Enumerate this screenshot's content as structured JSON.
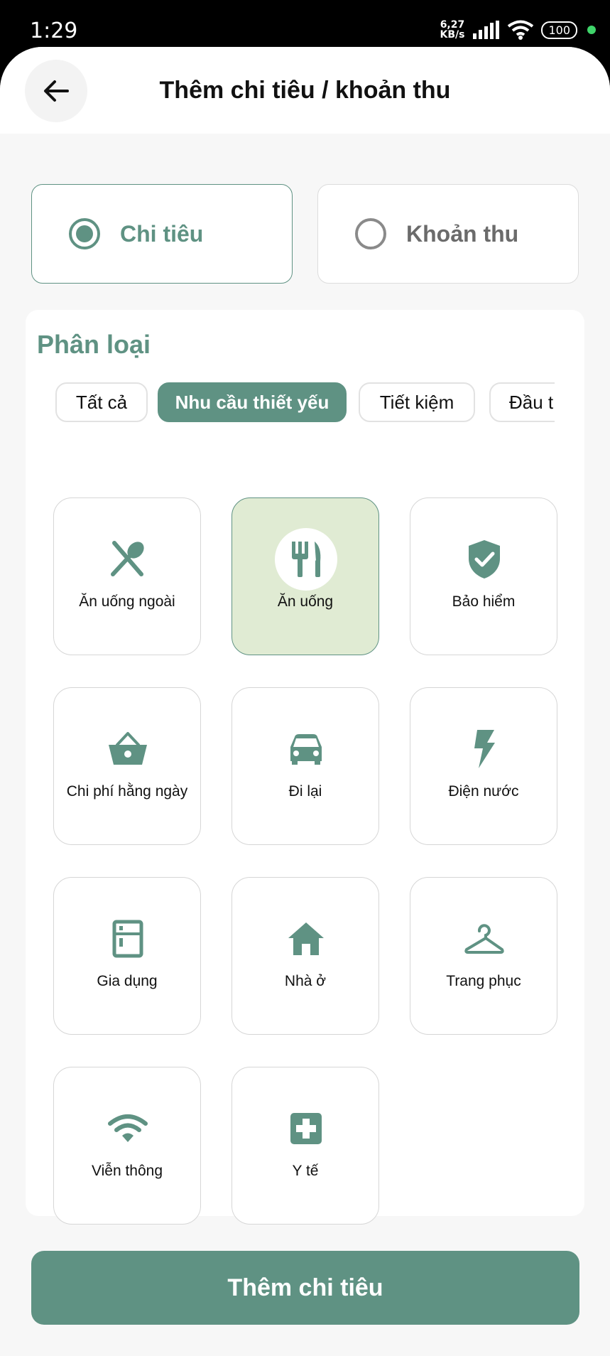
{
  "status_bar": {
    "time": "1:29",
    "net_speed_value": "6,27",
    "net_speed_unit": "KB/s",
    "battery": "100"
  },
  "header": {
    "title": "Thêm chi tiêu / khoản thu"
  },
  "type_toggle": {
    "expense_label": "Chi tiêu",
    "income_label": "Khoản thu",
    "selected": "expense"
  },
  "category": {
    "section_title": "Phân loại",
    "filters": [
      "Tất cả",
      "Nhu cầu thiết yếu",
      "Tiết kiệm",
      "Đầu t"
    ],
    "active_filter": "Nhu cầu thiết yếu",
    "items": [
      {
        "label": "Ăn uống ngoài",
        "icon": "fork-spoon-icon"
      },
      {
        "label": "Ăn uống",
        "icon": "fork-knife-icon",
        "selected": true
      },
      {
        "label": "Bảo hiểm",
        "icon": "shield-check-icon"
      },
      {
        "label": "Chi phí hằng ngày",
        "icon": "basket-icon"
      },
      {
        "label": "Đi lại",
        "icon": "car-icon"
      },
      {
        "label": "Điện nước",
        "icon": "bolt-icon"
      },
      {
        "label": "Gia dụng",
        "icon": "fridge-icon"
      },
      {
        "label": "Nhà ở",
        "icon": "home-icon"
      },
      {
        "label": "Trang phục",
        "icon": "hanger-icon"
      },
      {
        "label": "Viễn thông",
        "icon": "wifi-icon"
      },
      {
        "label": "Y tế",
        "icon": "medical-cross-icon"
      }
    ]
  },
  "submit": {
    "label": "Thêm chi tiêu"
  },
  "colors": {
    "accent": "#5f9283",
    "selected_tile_bg": "#e0ebd3",
    "page_bg": "#f7f7f7"
  }
}
